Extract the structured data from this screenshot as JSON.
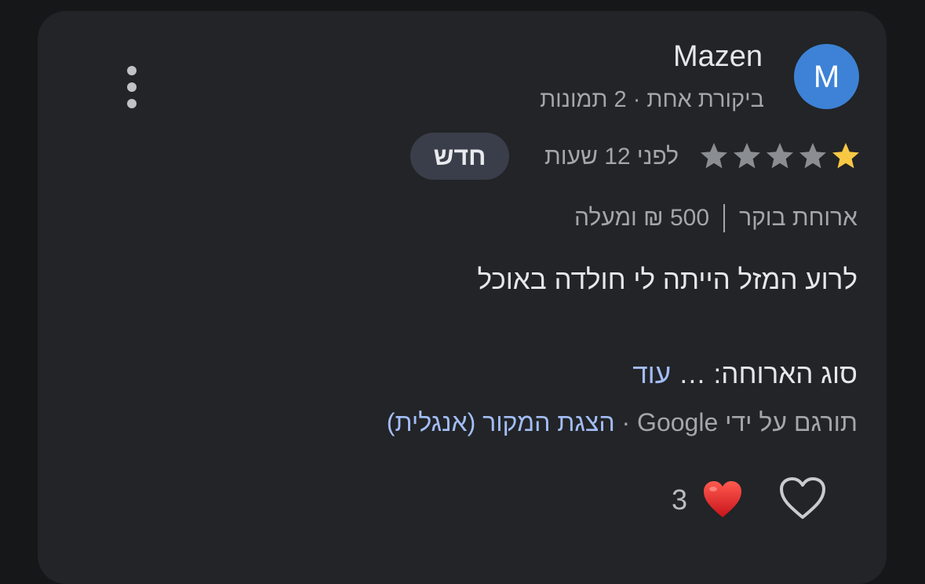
{
  "review": {
    "author": {
      "name": "Mazen",
      "avatar_letter": "M",
      "meta": "ביקורת אחת · 2 תמונות"
    },
    "rating": {
      "value": 1,
      "max": 5,
      "filled_color": "#f7c844",
      "empty_color": "#8a8d92"
    },
    "time": "לפני 12 שעות",
    "badge": "חדש",
    "tags": {
      "meal": "ארוחת בוקר",
      "price": "500 ₪ ומעלה"
    },
    "text": "לרוע המזל הייתה לי חולדה באוכל",
    "meal_type": {
      "label": "סוג הארוחה: …",
      "more": "עוד"
    },
    "translation": {
      "by": "תורגם על ידי Google ·",
      "show_original": "הצגת המקור (אנגלית)"
    },
    "reactions": {
      "count": "3",
      "heart_icon": "red-heart-emoji",
      "like_icon": "heart-outline-icon"
    },
    "menu_icon": "more-vertical-icon",
    "accent": "#3d82d6"
  }
}
